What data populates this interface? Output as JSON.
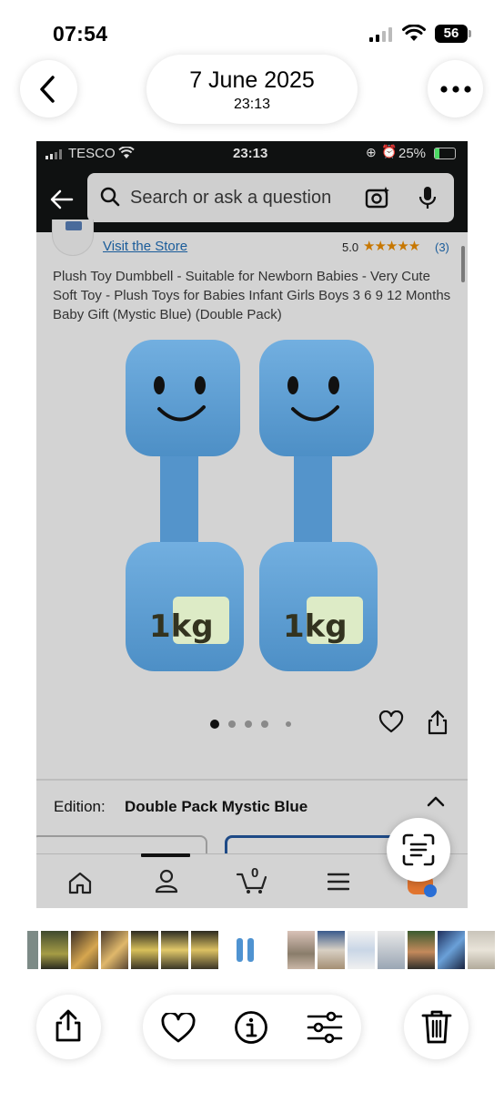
{
  "status_bar": {
    "time": "07:54",
    "battery": "56"
  },
  "header": {
    "date": "7 June 2025",
    "time": "23:13"
  },
  "screenshot": {
    "status": {
      "carrier": "TESCO",
      "time": "23:13",
      "battery": "25%"
    },
    "search": {
      "placeholder": "Search or ask a question"
    },
    "store": {
      "link": "Visit the Store",
      "rating": "5.0",
      "stars": "★★★★★",
      "count": "(3)"
    },
    "product": {
      "title": "Plush Toy Dumbbell - Suitable for Newborn Babies - Very Cute Soft Toy - Plush Toys for Babies Infant Girls Boys 3 6 9 12 Months Baby Gift (Mystic Blue) (Double Pack)",
      "image_dots": 5,
      "weight_label": "1kg"
    },
    "edition": {
      "label": "Edition:",
      "value": "Double Pack Mystic Blue"
    },
    "nav": {
      "cart_count": "0",
      "items": [
        "home-icon",
        "account-icon",
        "cart-icon",
        "menu-icon"
      ]
    }
  },
  "toolbar": {
    "items": [
      "share-icon",
      "heart-icon",
      "info-icon",
      "adjust-icon",
      "trash-icon"
    ]
  },
  "colors": {
    "amazon_dark": "#0f1111",
    "link_blue": "#1a5c9a",
    "star_orange": "#c77700",
    "plush_blue": "#5f9fd4"
  }
}
